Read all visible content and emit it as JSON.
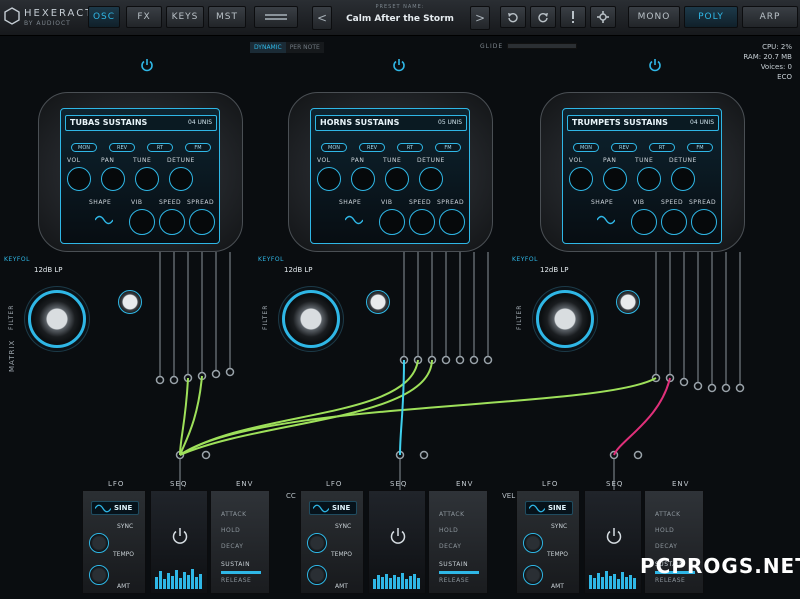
{
  "app": {
    "logo_title": "HEXERACT",
    "logo_sub": "BY AUDIOCT"
  },
  "nav": {
    "tabs": [
      {
        "label": "OSC",
        "active": true
      },
      {
        "label": "FX",
        "active": false
      },
      {
        "label": "KEYS",
        "active": false
      },
      {
        "label": "MST",
        "active": false
      }
    ]
  },
  "preset": {
    "label": "PRESET NAME:",
    "name": "Calm After the Storm",
    "prev": "<",
    "next": ">"
  },
  "modes": [
    {
      "label": "MONO",
      "active": false
    },
    {
      "label": "POLY",
      "active": true
    },
    {
      "label": "ARP",
      "active": false
    }
  ],
  "velocity_mode": {
    "dynamic": "DYNAMIC",
    "per_note": "PER NOTE"
  },
  "glide": {
    "label": "GLIDE"
  },
  "stats": {
    "cpu": "CPU: 2%",
    "ram": "RAM: 20.7 MB",
    "voices": "Voices: 0",
    "eco": "ECO"
  },
  "modules": [
    {
      "title": "TUBAS SUSTAINS",
      "unis": "04 UNIS",
      "tags": [
        "MON",
        "REV",
        "RT",
        "FM"
      ],
      "labels": {
        "vol": "VOL",
        "pan": "PAN",
        "tune": "TUNE",
        "detune": "DETUNE",
        "shape": "SHAPE",
        "vib": "VIB",
        "speed": "SPEED",
        "spread": "SPREAD"
      },
      "keyfol": "KEYFOL",
      "filter_type": "12dB LP",
      "filter_label": "FILTER"
    },
    {
      "title": "HORNS SUSTAINS",
      "unis": "05 UNIS",
      "tags": [
        "MON",
        "REV",
        "RT",
        "FM"
      ],
      "labels": {
        "vol": "VOL",
        "pan": "PAN",
        "tune": "TUNE",
        "detune": "DETUNE",
        "shape": "SHAPE",
        "vib": "VIB",
        "speed": "SPEED",
        "spread": "SPREAD"
      },
      "keyfol": "KEYFOL",
      "filter_type": "12dB LP",
      "filter_label": "FILTER"
    },
    {
      "title": "TRUMPETS SUSTAINS",
      "unis": "04 UNIS",
      "tags": [
        "MON",
        "REV",
        "RT",
        "FM"
      ],
      "labels": {
        "vol": "VOL",
        "pan": "PAN",
        "tune": "TUNE",
        "detune": "DETUNE",
        "shape": "SHAPE",
        "vib": "VIB",
        "speed": "SPEED",
        "spread": "SPREAD"
      },
      "keyfol": "KEYFOL",
      "filter_type": "12dB LP",
      "filter_label": "FILTER"
    }
  ],
  "matrix": {
    "label": "MATRIX",
    "cc": "CC",
    "vel": "VEL"
  },
  "lower": [
    {
      "lfo": "LFO",
      "seq": "SEQ",
      "env": "ENV",
      "wave": "SINE",
      "sync": "SYNC",
      "tempo": "TEMPO",
      "amt": "AMT",
      "env_items": [
        "ATTACK",
        "HOLD",
        "DECAY",
        "SUSTAIN",
        "RELEASE"
      ]
    },
    {
      "lfo": "LFO",
      "seq": "SEQ",
      "env": "ENV",
      "wave": "SINE",
      "sync": "SYNC",
      "tempo": "TEMPO",
      "amt": "AMT",
      "env_items": [
        "ATTACK",
        "HOLD",
        "DECAY",
        "SUSTAIN",
        "RELEASE"
      ]
    },
    {
      "lfo": "LFO",
      "seq": "SEQ",
      "env": "ENV",
      "wave": "SINE",
      "sync": "SYNC",
      "tempo": "TEMPO",
      "amt": "AMT",
      "env_items": [
        "ATTACK",
        "HOLD",
        "DECAY",
        "SUSTAIN",
        "RELEASE"
      ]
    }
  ],
  "watermark": {
    "text": "PCPROGS.NET"
  },
  "colors": {
    "accent": "#2fb7e6",
    "cable_green": "#9ee05a",
    "cable_cyan": "#3fd0ee",
    "cable_pink": "#e0307a"
  }
}
